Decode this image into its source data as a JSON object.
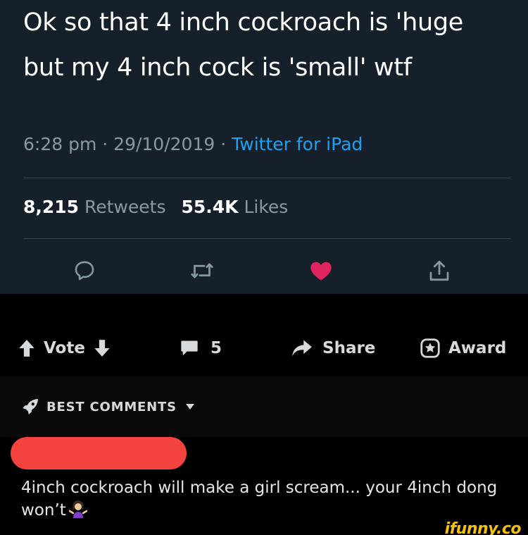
{
  "tweet": {
    "text_line1": "Ok so that 4 inch cockroach is 'huge",
    "text_line2": "but my 4 inch cock is 'small' wtf",
    "time": "6:28 pm",
    "date": "29/10/2019",
    "separator": "·",
    "source": "Twitter for iPad",
    "retweet_count": "8,215",
    "retweet_label": "Retweets",
    "like_count": "55.4K",
    "like_label": "Likes",
    "actions": [
      {
        "icon": "reply-icon"
      },
      {
        "icon": "retweet-icon"
      },
      {
        "icon": "heart-icon",
        "color": "#e0245e"
      },
      {
        "icon": "share-icon"
      }
    ],
    "colors": {
      "background": "#15202b",
      "link": "#1da1f2",
      "muted": "#8899a6"
    }
  },
  "reddit_bar": {
    "vote_label": "Vote",
    "comment_count": "5",
    "share_label": "Share",
    "award_label": "Award"
  },
  "best_comments": {
    "label": "BEST COMMENTS"
  },
  "comment": {
    "text": "4inch cockroach will make a girl scream... your 4inch dong won’t",
    "emoji": "woman-shrugging-icon",
    "redaction_color": "#f4433e"
  },
  "watermark": {
    "text": "ifunny.co",
    "color": "#f4c20d"
  }
}
